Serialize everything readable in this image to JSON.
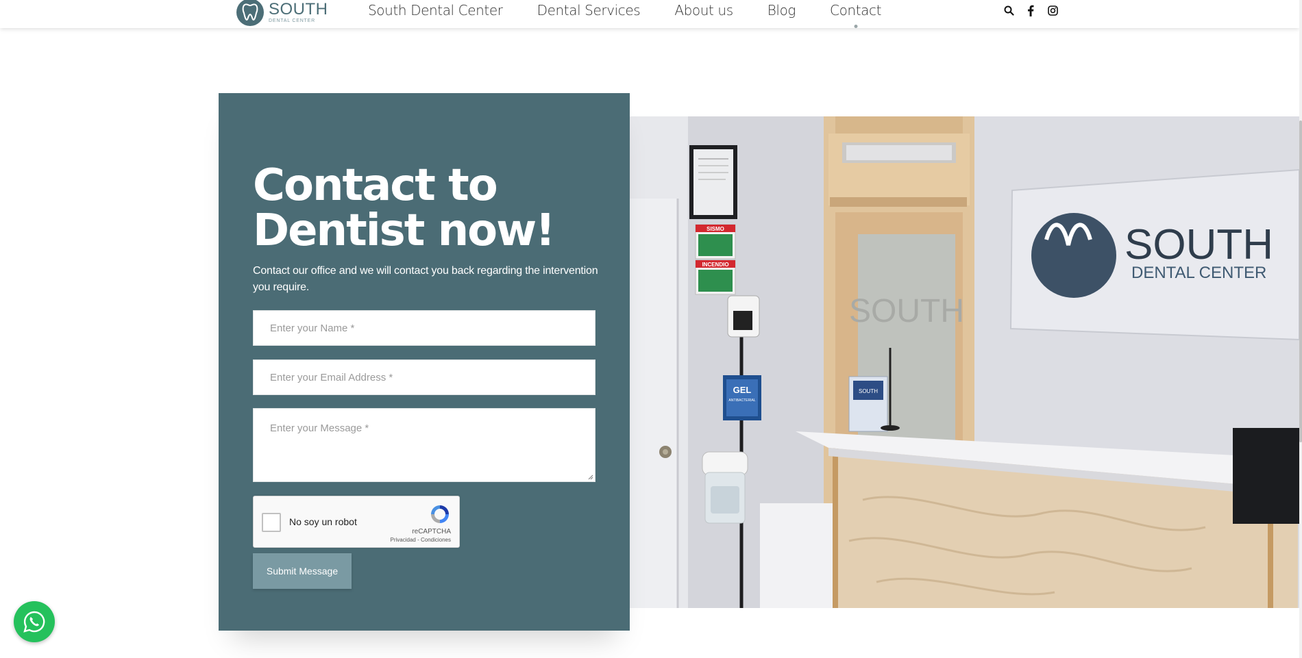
{
  "header": {
    "logo": {
      "brand": "SOUTH",
      "sub": "DENTAL CENTER"
    },
    "nav": [
      {
        "label": "South Dental Center"
      },
      {
        "label": "Dental Services"
      },
      {
        "label": "About us"
      },
      {
        "label": "Blog"
      },
      {
        "label": "Contact",
        "active": true
      }
    ],
    "icons": [
      "search-icon",
      "facebook-icon",
      "instagram-icon"
    ]
  },
  "contact": {
    "title": "Contact to Dentist now!",
    "description": "Contact our office and we will contact you back regarding the intervention you require.",
    "fields": {
      "name_placeholder": "Enter your Name *",
      "email_placeholder": "Enter your Email Address *",
      "message_placeholder": "Enter your Message *"
    },
    "recaptcha": {
      "label": "No soy un robot",
      "brand": "reCAPTCHA",
      "links": "Privacidad - Condiciones"
    },
    "submit_label": "Submit Message"
  },
  "photo": {
    "sign_brand": "SOUTH",
    "sign_sub": "DENTAL CENTER",
    "door_text": "SOUTH",
    "poster1": "SISMO",
    "poster2": "INCENDIO",
    "gel_label": "GEL",
    "gel_sub": "ANTIBACTERIAL",
    "brochure_label": "SOUTH"
  },
  "colors": {
    "panel": "#4b6c75",
    "button": "#7a9aa3",
    "logo": "#4c6e77",
    "whatsapp": "#25c15c"
  }
}
